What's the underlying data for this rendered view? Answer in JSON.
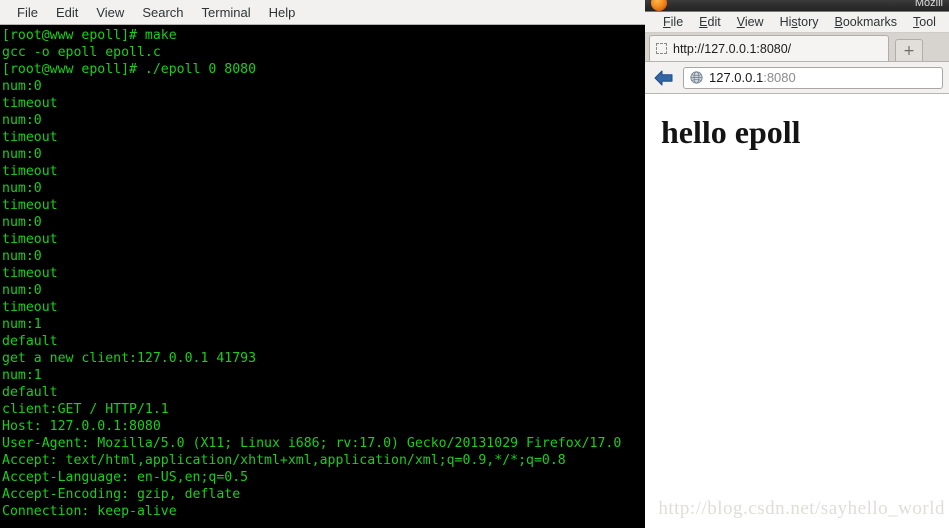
{
  "terminal": {
    "menu": [
      {
        "label": "File"
      },
      {
        "label": "Edit"
      },
      {
        "label": "View"
      },
      {
        "label": "Search"
      },
      {
        "label": "Terminal"
      },
      {
        "label": "Help"
      }
    ],
    "foreground_color": "#18d018",
    "background_color": "#000000",
    "lines": [
      "[root@www epoll]# make",
      "gcc -o epoll epoll.c",
      "[root@www epoll]# ./epoll 0 8080",
      "num:0",
      "timeout",
      "num:0",
      "timeout",
      "num:0",
      "timeout",
      "num:0",
      "timeout",
      "num:0",
      "timeout",
      "num:0",
      "timeout",
      "num:0",
      "timeout",
      "num:1",
      "default",
      "get a new client:127.0.0.1 41793",
      "num:1",
      "default",
      "client:GET / HTTP/1.1",
      "Host: 127.0.0.1:8080",
      "User-Agent: Mozilla/5.0 (X11; Linux i686; rv:17.0) Gecko/20131029 Firefox/17.0",
      "Accept: text/html,application/xhtml+xml,application/xml;q=0.9,*/*;q=0.8",
      "Accept-Language: en-US,en;q=0.5",
      "Accept-Encoding: gzip, deflate",
      "Connection: keep-alive"
    ]
  },
  "watermark": {
    "text": "http://blog.csdn.net/sayhello_world"
  },
  "browser": {
    "window_title": "Mozill",
    "menu": [
      {
        "pre": "",
        "acc": "F",
        "post": "ile"
      },
      {
        "pre": "",
        "acc": "E",
        "post": "dit"
      },
      {
        "pre": "",
        "acc": "V",
        "post": "iew"
      },
      {
        "pre": "Hi",
        "acc": "s",
        "post": "tory"
      },
      {
        "pre": "",
        "acc": "B",
        "post": "ookmarks"
      },
      {
        "pre": "",
        "acc": "T",
        "post": "ool"
      }
    ],
    "tab": {
      "title": "http://127.0.0.1:8080/",
      "newtab_label": "+"
    },
    "navigation": {
      "back_label": "Back",
      "url_host": "127.0.0.1",
      "url_port": ":8080"
    },
    "page": {
      "heading": "hello epoll"
    }
  }
}
